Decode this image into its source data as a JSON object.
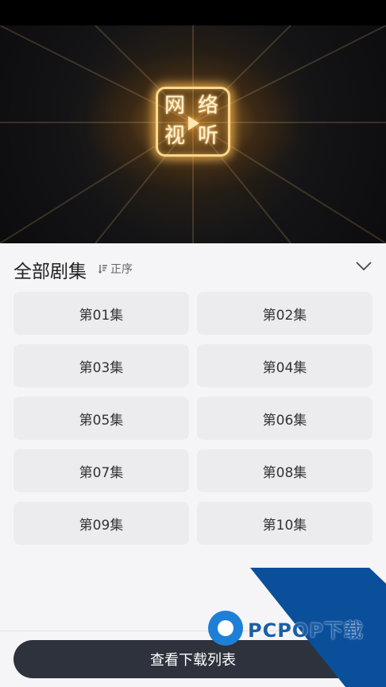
{
  "video": {
    "logo_glyphs": [
      "网",
      "络",
      "视",
      "听"
    ]
  },
  "episodes": {
    "title": "全部剧集",
    "sort_label": "正序",
    "items": [
      "第01集",
      "第02集",
      "第03集",
      "第04集",
      "第05集",
      "第06集",
      "第07集",
      "第08集",
      "第09集",
      "第10集"
    ]
  },
  "footer": {
    "download_label": "查看下载列表"
  },
  "watermark": {
    "text": "PCPOP下载"
  },
  "colors": {
    "button_dark": "#2d323c",
    "episode_bg": "#ececee",
    "watermark_blue": "#0a4f9a"
  }
}
